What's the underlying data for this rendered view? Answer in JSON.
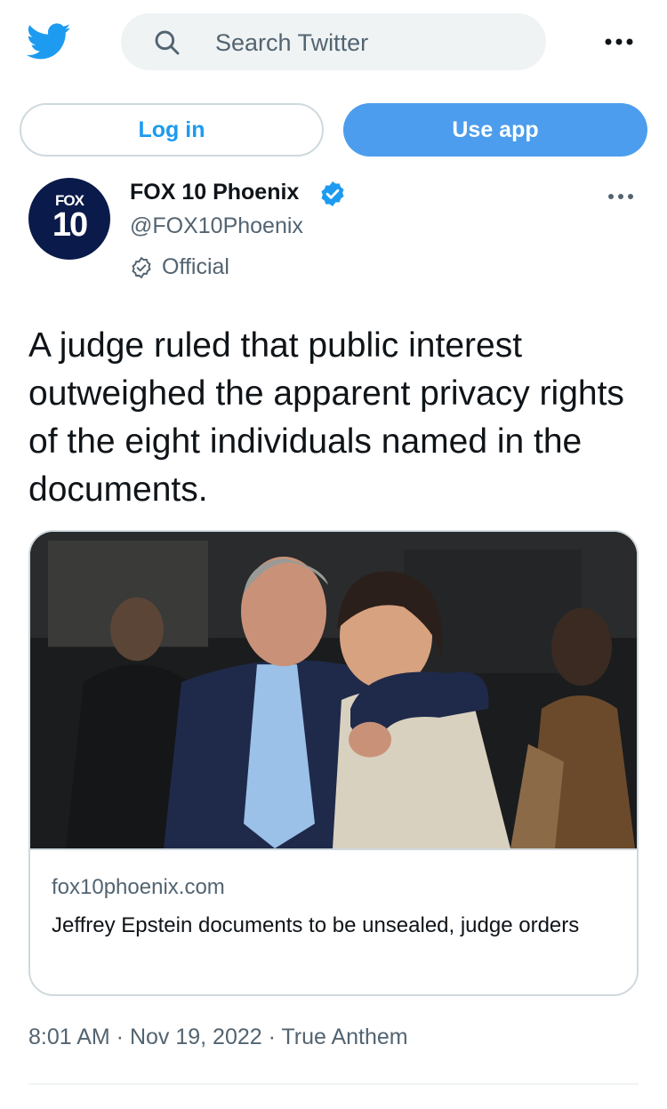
{
  "header": {
    "logo_icon": "twitter-bird-icon",
    "search_placeholder": "Search Twitter",
    "more_icon": "more-horizontal-icon"
  },
  "auth": {
    "login_label": "Log in",
    "use_app_label": "Use app"
  },
  "author": {
    "avatar_top": "FOX",
    "avatar_bottom": "10",
    "name": "FOX 10 Phoenix",
    "handle": "@FOX10Phoenix",
    "official_label": "Official",
    "verified_icon": "verified-badge-icon"
  },
  "tweet": {
    "text": "A judge ruled that public interest outweighed the apparent privacy rights of the eight individuals named in the documents.",
    "timestamp": "8:01 AM · Nov 19, 2022 · True Anthem"
  },
  "card": {
    "domain": "fox10phoenix.com",
    "title": "Jeffrey Epstein documents to be unsealed, judge orders"
  },
  "colors": {
    "accent": "#1d9bf0",
    "use_app_bg": "#4c9ded",
    "secondary_text": "#536471",
    "border": "#cfd9de"
  }
}
